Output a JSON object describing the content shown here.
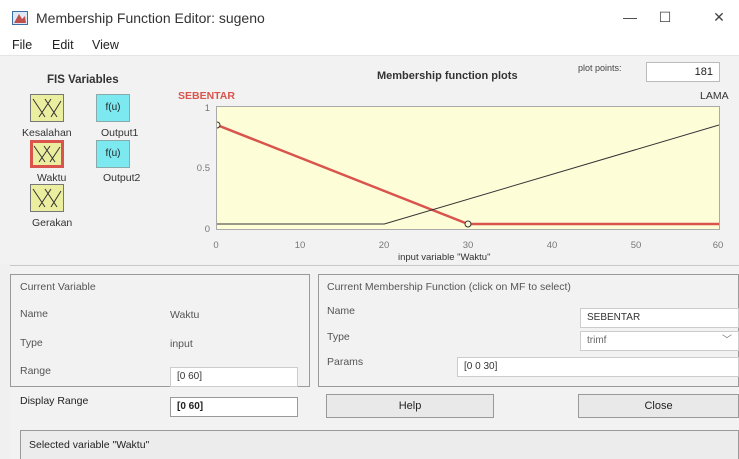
{
  "window": {
    "title": "Membership Function Editor: sugeno",
    "controls": [
      "—",
      "☐",
      "✕"
    ]
  },
  "menu": [
    "File",
    "Edit",
    "View"
  ],
  "fis": {
    "title": "FIS Variables",
    "inputs": [
      "Kesalahan",
      "Waktu",
      "Gerakan"
    ],
    "outputs": [
      "Output1",
      "Output2"
    ],
    "output_box_label": "f(u)",
    "selected": "Waktu"
  },
  "plot": {
    "title": "Membership function plots",
    "points_label": "plot points:",
    "points_value": "181",
    "mf_left_label": "SEBENTAR",
    "mf_right_label": "LAMA",
    "xlabel": "input variable \"Waktu\"",
    "yticks": [
      "1",
      "0.5",
      "0"
    ],
    "xticks": [
      "0",
      "10",
      "20",
      "30",
      "40",
      "50",
      "60"
    ]
  },
  "chart_data": {
    "type": "line",
    "xlabel": "input variable \"Waktu\"",
    "xlim": [
      0,
      60
    ],
    "ylim": [
      0,
      1
    ],
    "series": [
      {
        "name": "SEBENTAR",
        "x": [
          0,
          0,
          30,
          60
        ],
        "y": [
          1,
          1,
          0,
          0
        ],
        "color": "#d9544c",
        "selected": true
      },
      {
        "name": "LAMA",
        "x": [
          0,
          20,
          60,
          60
        ],
        "y": [
          0,
          0,
          1,
          1
        ],
        "color": "#333333",
        "selected": false
      }
    ]
  },
  "current_variable": {
    "header": "Current Variable",
    "name_label": "Name",
    "name_value": "Waktu",
    "type_label": "Type",
    "type_value": "input",
    "range_label": "Range",
    "range_value": "[0 60]",
    "display_range_label": "Display Range",
    "display_range_value": "[0 60]"
  },
  "current_mf": {
    "header": "Current Membership Function (click on MF to select)",
    "name_label": "Name",
    "name_value": "SEBENTAR",
    "type_label": "Type",
    "type_value": "trimf",
    "params_label": "Params",
    "params_value": "[0 0 30]"
  },
  "buttons": {
    "help": "Help",
    "close": "Close"
  },
  "status": "Selected variable \"Waktu\"",
  "colors": {
    "plot_bg": "#fdfdd8",
    "input_box": "#ecee9f",
    "output_box": "#7ce8f0",
    "selected": "#d9544c"
  }
}
